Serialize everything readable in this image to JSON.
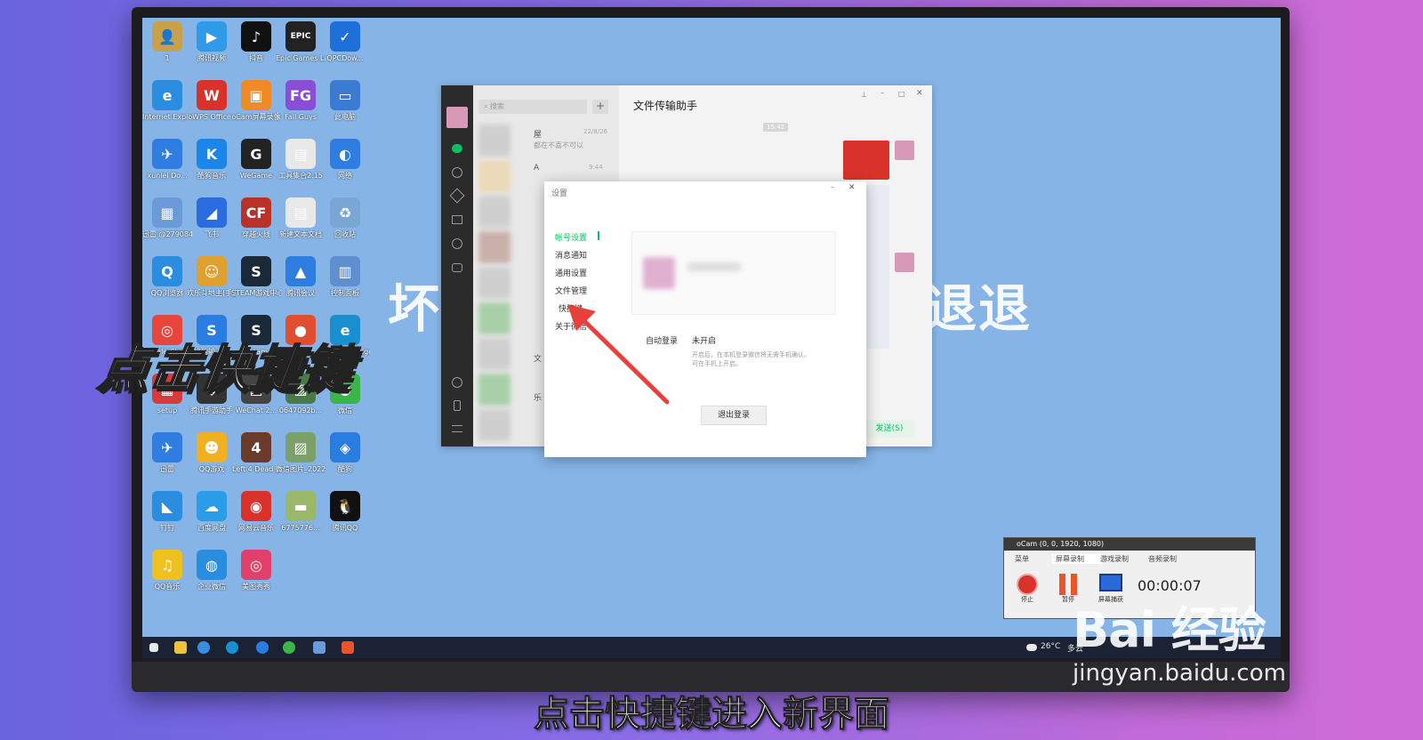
{
  "desktop": {
    "icons": [
      {
        "label": "1",
        "glyph": "👤",
        "color": "#c9a14a"
      },
      {
        "label": "腾讯视频",
        "glyph": "▶",
        "color": "#2f9be8"
      },
      {
        "label": "抖音",
        "glyph": "♪",
        "color": "#111111"
      },
      {
        "label": "Epic Games Launcher",
        "glyph": "EPIC",
        "color": "#222222"
      },
      {
        "label": "QPCDow...",
        "glyph": "✓",
        "color": "#1e6fd9"
      },
      {
        "label": "Internet Explorer",
        "glyph": "e",
        "color": "#2a8de0"
      },
      {
        "label": "WPS Office",
        "glyph": "W",
        "color": "#d8322a"
      },
      {
        "label": "oCam屏幕录像",
        "glyph": "▣",
        "color": "#f08a24"
      },
      {
        "label": "Fall Guys",
        "glyph": "FG",
        "color": "#8a4dd6"
      },
      {
        "label": "此电脑",
        "glyph": "▭",
        "color": "#3b7bd1"
      },
      {
        "label": "xunlei Do...",
        "glyph": "✈",
        "color": "#2f7de0"
      },
      {
        "label": "酷狗音乐",
        "glyph": "K",
        "color": "#1a86e8"
      },
      {
        "label": "WeGame",
        "glyph": "G",
        "color": "#222222"
      },
      {
        "label": "工具集合2.15",
        "glyph": "▤",
        "color": "#e8e8e8"
      },
      {
        "label": "网络",
        "glyph": "◐",
        "color": "#2f7de0"
      },
      {
        "label": "迅雷 @279084...",
        "glyph": "▦",
        "color": "#6a9bd8"
      },
      {
        "label": "飞书",
        "glyph": "◢",
        "color": "#2b6de0"
      },
      {
        "label": "穿越火线",
        "glyph": "CF",
        "color": "#b8322a"
      },
      {
        "label": "新建文本文档",
        "glyph": "▤",
        "color": "#e8e8e8"
      },
      {
        "label": "回收站",
        "glyph": "♻",
        "color": "#7aa6d6"
      },
      {
        "label": "QQ浏览器",
        "glyph": "Q",
        "color": "#2a8de0"
      },
      {
        "label": "欢乐斗地主(手游电脑版)",
        "glyph": "☺",
        "color": "#e0a030"
      },
      {
        "label": "STEAM游戏中心",
        "glyph": "S",
        "color": "#1b2838"
      },
      {
        "label": "腾讯会议",
        "glyph": "▲",
        "color": "#2f7de0"
      },
      {
        "label": "控制面板",
        "glyph": "▥",
        "color": "#5f8fcf"
      },
      {
        "label": "Google Chrome",
        "glyph": "◎",
        "color": "#e8453c"
      },
      {
        "label": "搜狗输入法",
        "glyph": "S",
        "color": "#2a7de0"
      },
      {
        "label": "Steam",
        "glyph": "S",
        "color": "#1b2838"
      },
      {
        "label": "小鸟",
        "glyph": "●",
        "color": "#e05030"
      },
      {
        "label": "Microsoft Edge",
        "glyph": "e",
        "color": "#1a8fd0"
      },
      {
        "label": "setup",
        "glyph": "▦",
        "color": "#d83a3a"
      },
      {
        "label": "腾讯手游助手",
        "glyph": "◆",
        "color": "#333333"
      },
      {
        "label": "WeChat 2...",
        "glyph": "▤",
        "color": "#444444"
      },
      {
        "label": "0647092b...",
        "glyph": "▨",
        "color": "#4a7a4a"
      },
      {
        "label": "微信",
        "glyph": "●",
        "color": "#3bb44a"
      },
      {
        "label": "迅雷",
        "glyph": "✈",
        "color": "#2f7de0"
      },
      {
        "label": "QQ游戏",
        "glyph": "☻",
        "color": "#f0b020"
      },
      {
        "label": "Left 4 Dead 2",
        "glyph": "4",
        "color": "#6a3a2a"
      },
      {
        "label": "微信图片_2022030...",
        "glyph": "▨",
        "color": "#7ca06a"
      },
      {
        "label": "酷狗",
        "glyph": "◈",
        "color": "#2a7de0"
      },
      {
        "label": "钉钉",
        "glyph": "◣",
        "color": "#2a8de0"
      },
      {
        "label": "百度网盘",
        "glyph": "☁",
        "color": "#2a9de8"
      },
      {
        "label": "网易云音乐",
        "glyph": "◉",
        "color": "#d8322a"
      },
      {
        "label": "6775776...",
        "glyph": "▬",
        "color": "#9ab86a"
      },
      {
        "label": "腾讯QQ",
        "glyph": "🐧",
        "color": "#111111"
      },
      {
        "label": "QQ音乐",
        "glyph": "♫",
        "color": "#f0c020"
      },
      {
        "label": "企业微信",
        "glyph": "◍",
        "color": "#2a8de0"
      },
      {
        "label": "美图秀秀",
        "glyph": "◎",
        "color": "#e0406a"
      }
    ],
    "background_words": {
      "left": "坏",
      "right": "退退"
    }
  },
  "wechat": {
    "search_placeholder": "搜索",
    "add_button": "+",
    "chat_title": "文件传输助手",
    "time_stamp": "15:42",
    "send_button": "发送(S)",
    "list_preview_1_date": "22/8/26",
    "list_preview_1_text": "都在不喜不可以",
    "list_preview_2_time": "9:44",
    "list_preview_2_name": "A",
    "list_preview_1_name": "屋",
    "list_preview_3_name": "文",
    "list_preview_4_name": "乐"
  },
  "settings": {
    "title": "设置",
    "menu": [
      "帐号设置",
      "消息通知",
      "通用设置",
      "文件管理",
      "快捷键",
      "关于微信"
    ],
    "active_index": 0,
    "auto_login_label": "自动登录",
    "auto_login_value": "未开启",
    "auto_login_desc_1": "开启后，在本机登录微信将无需手机确认。",
    "auto_login_desc_2": "可在手机上开启。",
    "logout_button": "退出登录"
  },
  "taskbar": {
    "weather": "26°C",
    "weather_desc": "多云"
  },
  "ocam": {
    "title": "oCam (0, 0, 1920, 1080)",
    "tabs": [
      "菜单",
      "屏幕录制",
      "游戏录制",
      "音频录制"
    ],
    "buttons": [
      "停止",
      "暂停",
      "屏幕捕获"
    ],
    "timer": "00:00:07"
  },
  "overlay": {
    "big_text": "点击快捷键",
    "caption": "点击快捷键进入新界面",
    "watermark_main": "Bai 经验",
    "watermark_url": "jingyan.baidu.com"
  },
  "colors": {
    "wechat_green": "#07c160",
    "arrow_red": "#e8403a",
    "ocam_red": "#d8322a"
  }
}
